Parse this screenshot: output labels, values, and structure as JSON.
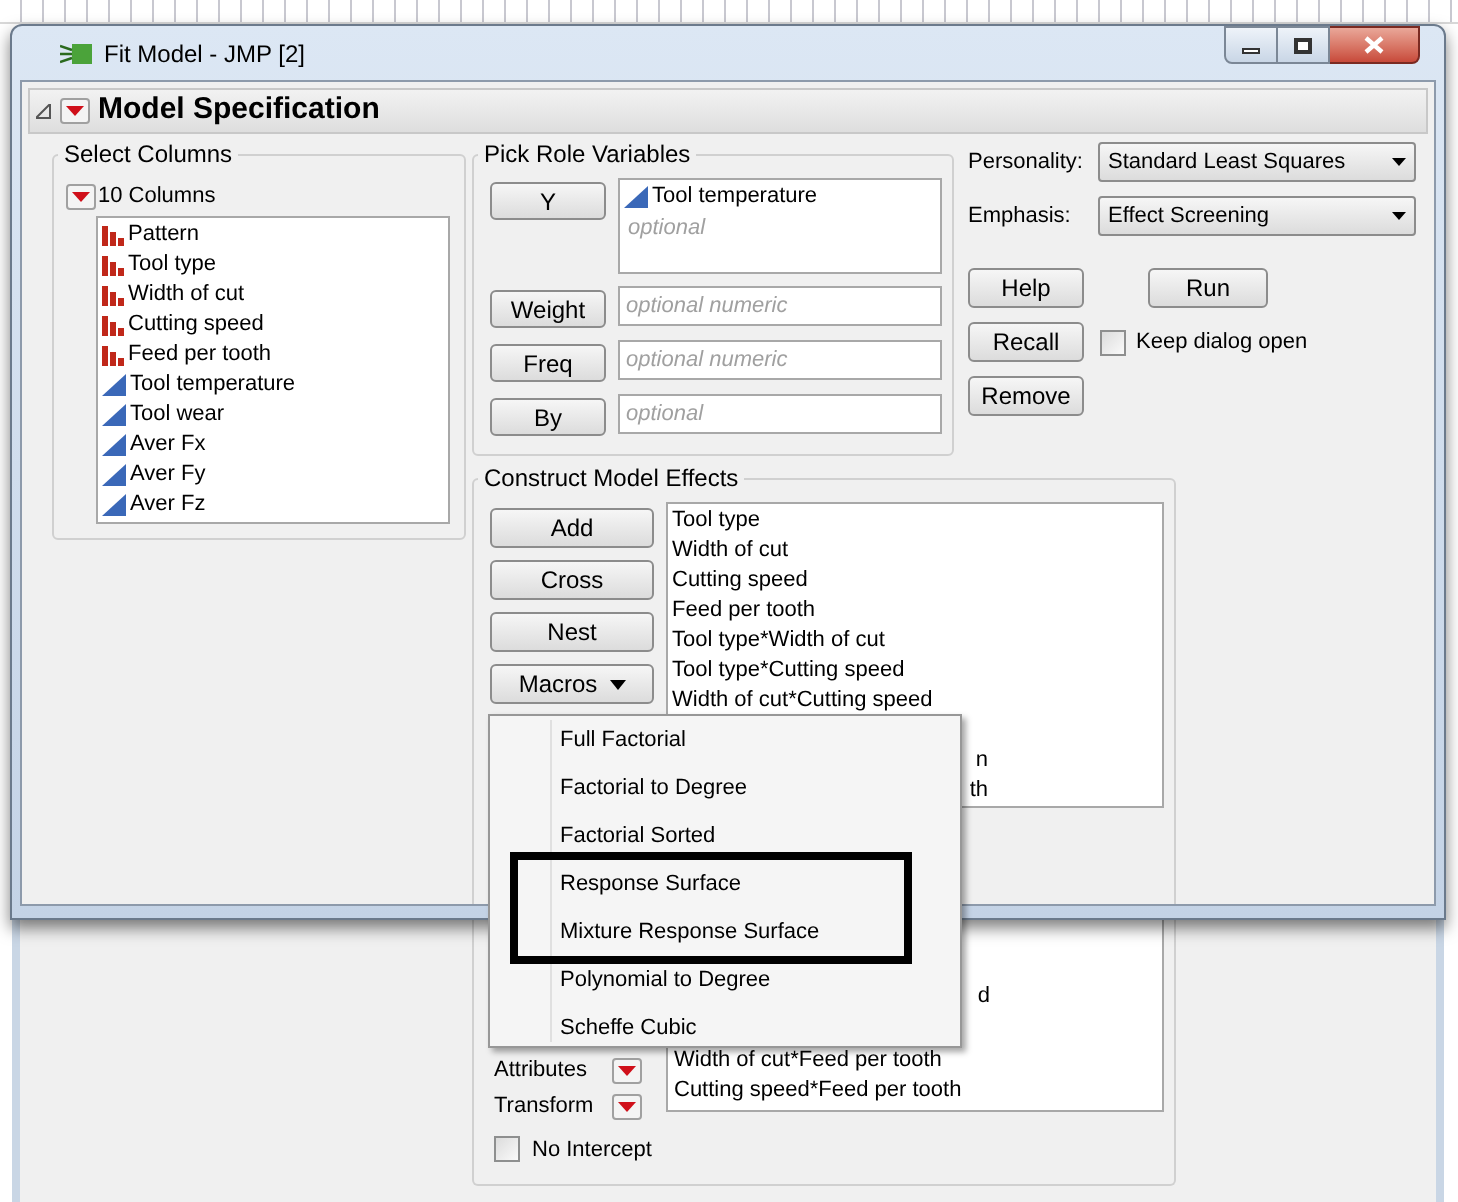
{
  "window": {
    "title": "Fit Model - JMP [2]"
  },
  "header": {
    "title": "Model Specification"
  },
  "select_columns": {
    "title": "Select Columns",
    "count_label": "10 Columns",
    "columns": [
      {
        "name": "Pattern",
        "kind": "nominal"
      },
      {
        "name": "Tool type",
        "kind": "nominal"
      },
      {
        "name": "Width of cut",
        "kind": "nominal"
      },
      {
        "name": "Cutting speed",
        "kind": "nominal"
      },
      {
        "name": "Feed per tooth",
        "kind": "nominal"
      },
      {
        "name": "Tool temperature",
        "kind": "continuous"
      },
      {
        "name": "Tool wear",
        "kind": "continuous"
      },
      {
        "name": "Aver Fx",
        "kind": "continuous"
      },
      {
        "name": "Aver Fy",
        "kind": "continuous"
      },
      {
        "name": "Aver Fz",
        "kind": "continuous"
      }
    ]
  },
  "pick_role_variables": {
    "title": "Pick Role Variables",
    "roles": [
      {
        "button": "Y",
        "kind": "list",
        "values": [
          {
            "name": "Tool temperature",
            "kind": "continuous"
          }
        ],
        "hint": "optional"
      },
      {
        "button": "Weight",
        "kind": "field",
        "placeholder": "optional numeric"
      },
      {
        "button": "Freq",
        "kind": "field",
        "placeholder": "optional numeric"
      },
      {
        "button": "By",
        "kind": "field",
        "placeholder": "optional"
      }
    ]
  },
  "personality": {
    "label": "Personality:",
    "value": "Standard Least Squares"
  },
  "emphasis": {
    "label": "Emphasis:",
    "value": "Effect Screening"
  },
  "buttons": {
    "help": "Help",
    "run": "Run",
    "recall": "Recall",
    "remove": "Remove"
  },
  "keep_dialog_open": {
    "label": "Keep dialog open",
    "checked": false
  },
  "construct_model_effects": {
    "title": "Construct Model Effects",
    "buttons": [
      "Add",
      "Cross",
      "Nest"
    ],
    "macros_button": "Macros",
    "effects_top": [
      {
        "text": "Tool type",
        "kind": "full"
      },
      {
        "text": "Width of cut",
        "kind": "full"
      },
      {
        "text": "Cutting speed",
        "kind": "full"
      },
      {
        "text": "Feed per tooth",
        "kind": "full"
      },
      {
        "text": "Tool type*Width of cut",
        "kind": "full"
      },
      {
        "text": "Tool type*Cutting speed",
        "kind": "full"
      },
      {
        "text": "Width of cut*Cutting speed",
        "kind": "full"
      },
      {
        "text": "n",
        "kind": "tail"
      },
      {
        "text": "th",
        "kind": "tail"
      }
    ],
    "effects_bottom": [
      {
        "text": "d",
        "kind": "tail"
      },
      {
        "text": "Width of cut*Feed per tooth",
        "kind": "full"
      },
      {
        "text": "Cutting speed*Feed per tooth",
        "kind": "full"
      }
    ],
    "attributes_label": "Attributes",
    "transform_label": "Transform",
    "no_intercept": {
      "label": "No Intercept",
      "checked": false
    }
  },
  "macros_menu": {
    "items": [
      {
        "label": "Full Factorial",
        "highlighted": false
      },
      {
        "label": "Factorial to Degree",
        "highlighted": false
      },
      {
        "label": "Factorial Sorted",
        "highlighted": false
      },
      {
        "label": "Response Surface",
        "highlighted": true
      },
      {
        "label": "Mixture Response Surface",
        "highlighted": true
      },
      {
        "label": "Polynomial to Degree",
        "highlighted": false
      },
      {
        "label": "Scheffe Cubic",
        "highlighted": false
      }
    ]
  }
}
